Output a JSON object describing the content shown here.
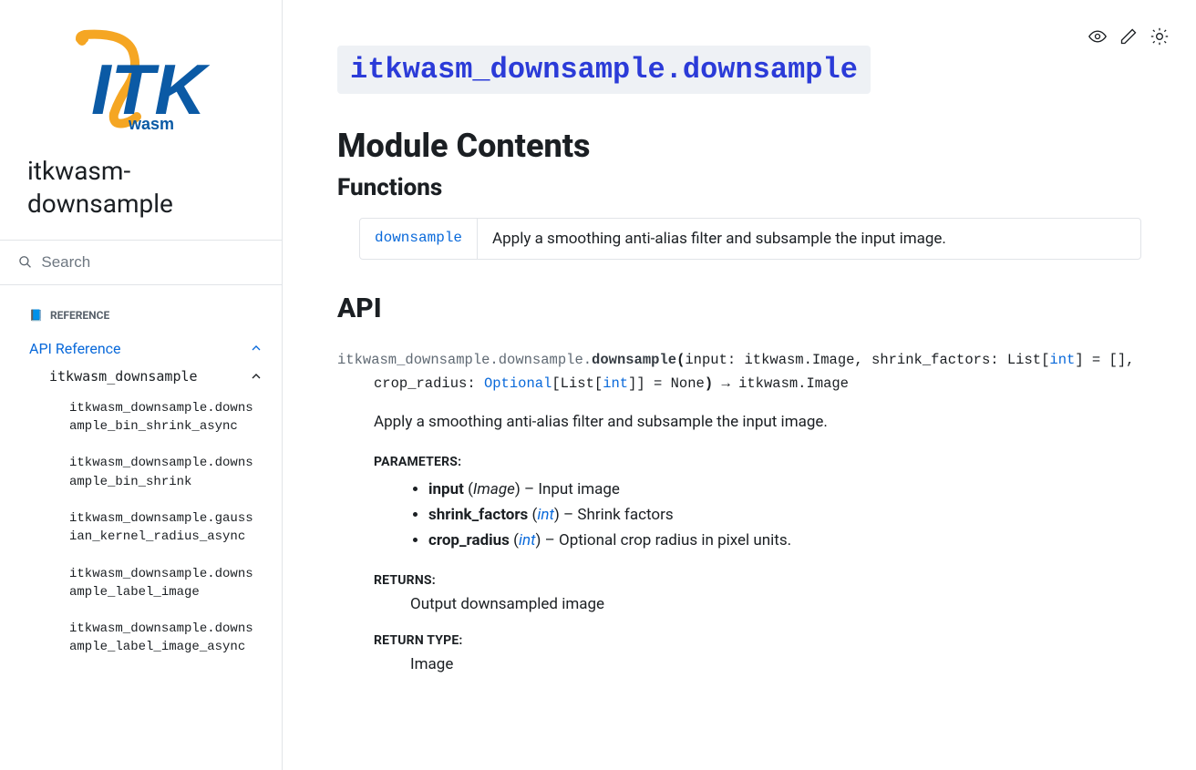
{
  "sidebar": {
    "brand": "itkwasm-downsample",
    "search_placeholder": "Search",
    "nav_heading": "REFERENCE",
    "nav_icon": "📘",
    "api_reference": "API Reference",
    "module": "itkwasm_downsample",
    "items": [
      "itkwasm_downsample.downsample_bin_shrink_async",
      "itkwasm_downsample.downsample_bin_shrink",
      "itkwasm_downsample.gaussian_kernel_radius_async",
      "itkwasm_downsample.downsample_label_image",
      "itkwasm_downsample.downsample_label_image_async"
    ]
  },
  "main": {
    "title": "itkwasm_downsample.downsample",
    "contents_heading": "Module Contents",
    "functions_heading": "Functions",
    "func_name": "downsample",
    "func_desc": "Apply a smoothing anti-alias filter and subsample the input image.",
    "api_heading": "API",
    "signature": {
      "qualifier": "itkwasm_downsample.downsample.",
      "name": "downsample",
      "param_input": "input",
      "type_image": "itkwasm.Image",
      "param_shrink": "shrink_factors",
      "type_list": "List",
      "type_int": "int",
      "default_list": "[]",
      "param_crop": "crop_radius",
      "type_optional": "Optional",
      "default_none": "None",
      "return_type": "itkwasm.Image"
    },
    "description": "Apply a smoothing anti-alias filter and subsample the input image.",
    "labels": {
      "parameters": "PARAMETERS:",
      "returns": "RETURNS:",
      "return_type": "RETURN TYPE:"
    },
    "params": [
      {
        "name": "input",
        "type": "Image",
        "type_link": false,
        "desc": "Input image"
      },
      {
        "name": "shrink_factors",
        "type": "int",
        "type_link": true,
        "desc": "Shrink factors"
      },
      {
        "name": "crop_radius",
        "type": "int",
        "type_link": true,
        "desc": "Optional crop radius in pixel units."
      }
    ],
    "returns": "Output downsampled image",
    "return_type": "Image"
  }
}
